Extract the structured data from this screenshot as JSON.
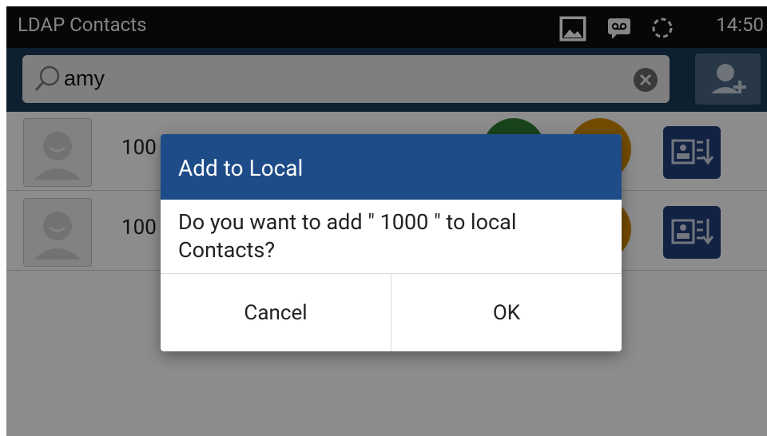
{
  "statusbar": {
    "title": "LDAP Contacts",
    "clock": "14:50",
    "icons": [
      "image-icon",
      "voicemail-icon",
      "sync-icon"
    ]
  },
  "search": {
    "value": "amy",
    "placeholder": "",
    "icons": [
      "search-icon",
      "clear-icon",
      "add-contact-icon"
    ]
  },
  "list": {
    "rows": [
      {
        "number_prefix": "100"
      },
      {
        "number_prefix": "100"
      }
    ],
    "colors": {
      "call": "#2e7d32",
      "video": "#d08a00",
      "import": "#1f3f7a"
    }
  },
  "dialog": {
    "title": "Add to Local",
    "message": "Do you want to add \" 1000 \" to local Contacts?",
    "cancel_label": "Cancel",
    "ok_label": "OK"
  },
  "colors": {
    "header": "#1e4c88",
    "searchbar": "#1b3a57"
  }
}
